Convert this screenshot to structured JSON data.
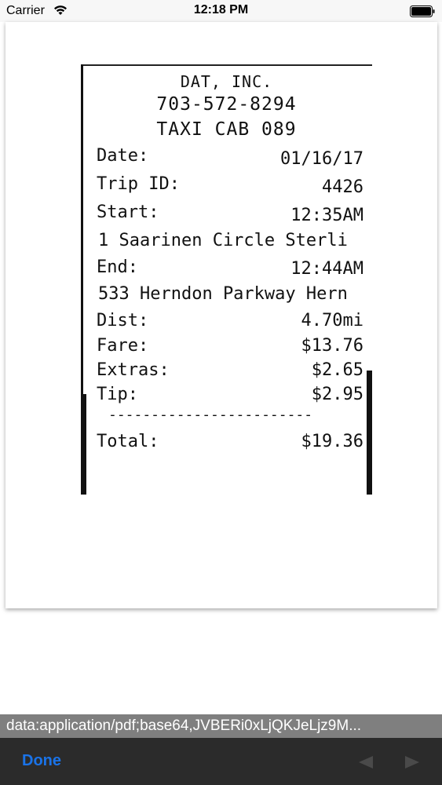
{
  "status_bar": {
    "carrier": "Carrier",
    "time": "12:18 PM",
    "wifi_icon": "wifi-icon",
    "battery_icon": "battery-icon"
  },
  "receipt": {
    "company": "DAT, INC.",
    "phone": "703-572-8294",
    "cab": "TAXI CAB 089",
    "date_label": "Date:",
    "date_value": "01/16/17",
    "trip_label": "Trip ID:",
    "trip_value": "4426",
    "start_label": "Start:",
    "start_value": "12:35AM",
    "start_address": "1 Saarinen Circle Sterli",
    "end_label": "End:",
    "end_value": "12:44AM",
    "end_address": "533 Herndon Parkway Hern",
    "dist_label": "Dist:",
    "dist_value": "4.70mi",
    "fare_label": "Fare:",
    "fare_value": "$13.76",
    "extras_label": "Extras:",
    "extras_value": "$2.65",
    "tip_label": "Tip:",
    "tip_value": "$2.95",
    "separator": "------------------------",
    "total_label": "Total:",
    "total_value": "$19.36"
  },
  "url_bar": {
    "url": "data:application/pdf;base64,JVBERi0xLjQKJeLjz9M..."
  },
  "toolbar": {
    "done_label": "Done",
    "back_icon": "back-arrow-icon",
    "forward_icon": "forward-arrow-icon",
    "done_color": "#1a73e8",
    "disabled_color": "#4a4a4a"
  }
}
